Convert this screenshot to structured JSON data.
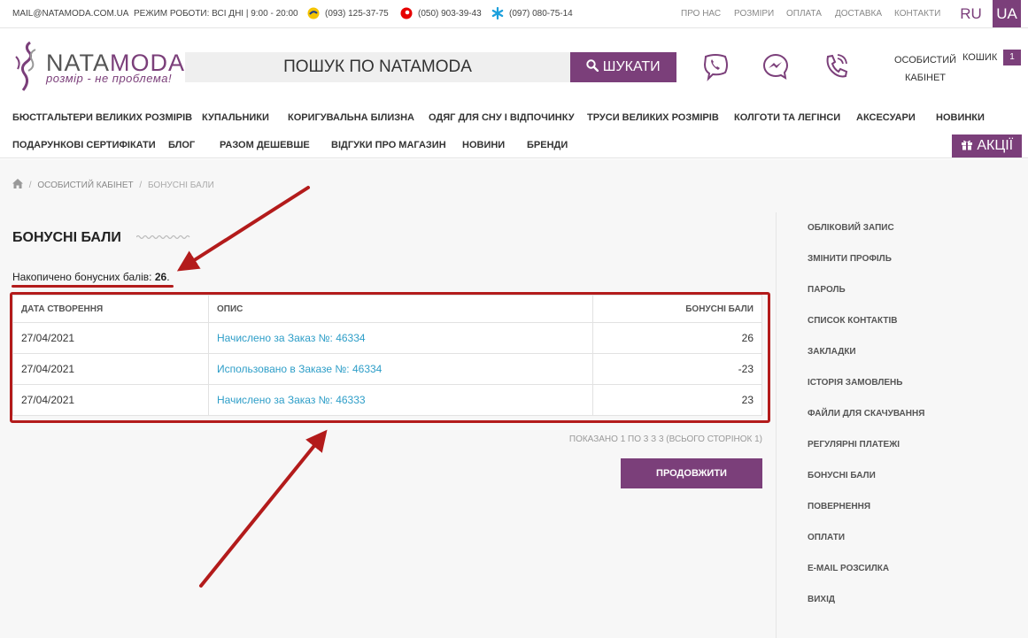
{
  "topbar": {
    "email": "MAIL@NATAMODA.COM.UA",
    "hours": "РЕЖИМ РОБОТИ: ВСІ ДНІ | 9:00 - 20:00",
    "phones": [
      "(093) 125-37-75",
      "(050) 903-39-43",
      "(097) 080-75-14"
    ],
    "links": [
      "ПРО НАС",
      "РОЗМІРИ",
      "ОПЛАТА",
      "ДОСТАВКА",
      "КОНТАКТИ"
    ],
    "lang_ru": "RU",
    "lang_ua": "UA"
  },
  "header": {
    "logo_nata": "NATA",
    "logo_moda": "MODA",
    "logo_tagline": "розмір - не проблема!",
    "search_placeholder": "ПОШУК ПО NATAMODA",
    "search_button": "ШУКАТИ",
    "account_line1": "ОСОБИСТИЙ",
    "account_line2": "КАБІНЕТ",
    "cart_label": "КОШИК",
    "cart_count": "1"
  },
  "nav": {
    "row1": [
      "БЮСТГАЛЬТЕРИ ВЕЛИКИХ РОЗМІРІВ",
      "КУПАЛЬНИКИ",
      "КОРИГУВАЛЬНА БІЛИЗНА",
      "ОДЯГ ДЛЯ СНУ І ВІДПОЧИНКУ",
      "ТРУСИ ВЕЛИКИХ РОЗМІРІВ",
      "КОЛГОТИ ТА ЛЕГІНСИ",
      "АКСЕСУАРИ",
      "НОВИНКИ"
    ],
    "row2": [
      "ПОДАРУНКОВІ СЕРТИФІКАТИ",
      "БЛОГ",
      "РАЗОМ ДЕШЕВШЕ",
      "ВІДГУКИ ПРО МАГАЗИН",
      "НОВИНИ",
      "БРЕНДИ"
    ],
    "promo": "АКЦІЇ"
  },
  "breadcrumb": {
    "items": [
      "ОСОБИСТИЙ КАБІНЕТ",
      "БОНУСНІ БАЛИ"
    ]
  },
  "main": {
    "title": "БОНУСНІ БАЛИ",
    "accum_label": "Накопичено бонусних балів:",
    "accum_value": "26",
    "table": {
      "headers": [
        "ДАТА СТВОРЕННЯ",
        "ОПИС",
        "БОНУСНІ БАЛИ"
      ],
      "rows": [
        {
          "date": "27/04/2021",
          "desc": "Начислено за Заказ №: 46334",
          "points": "26"
        },
        {
          "date": "27/04/2021",
          "desc": "Использовано в Заказе №: 46334",
          "points": "-23"
        },
        {
          "date": "27/04/2021",
          "desc": "Начислено за Заказ №: 46333",
          "points": "23"
        }
      ]
    },
    "pagination": "ПОКАЗАНО 1 ПО 3 З 3 (ВСЬОГО СТОРІНОК 1)",
    "continue_button": "ПРОДОВЖИТИ"
  },
  "sidebar": {
    "items": [
      "ОБЛІКОВИЙ ЗАПИС",
      "ЗМІНИТИ ПРОФІЛЬ",
      "ПАРОЛЬ",
      "СПИСОК КОНТАКТІВ",
      "ЗАКЛАДКИ",
      "ІСТОРІЯ ЗАМОВЛЕНЬ",
      "ФАЙЛИ ДЛЯ СКАЧУВАННЯ",
      "РЕГУЛЯРНІ ПЛАТЕЖІ",
      "БОНУСНІ БАЛИ",
      "ПОВЕРНЕННЯ",
      "ОПЛАТИ",
      "E-MAIL РОЗСИЛКА",
      "ВИХІД"
    ]
  },
  "colors": {
    "brand": "#7b3f7a",
    "annotation": "#b31b1b",
    "link": "#2e9ec8"
  }
}
